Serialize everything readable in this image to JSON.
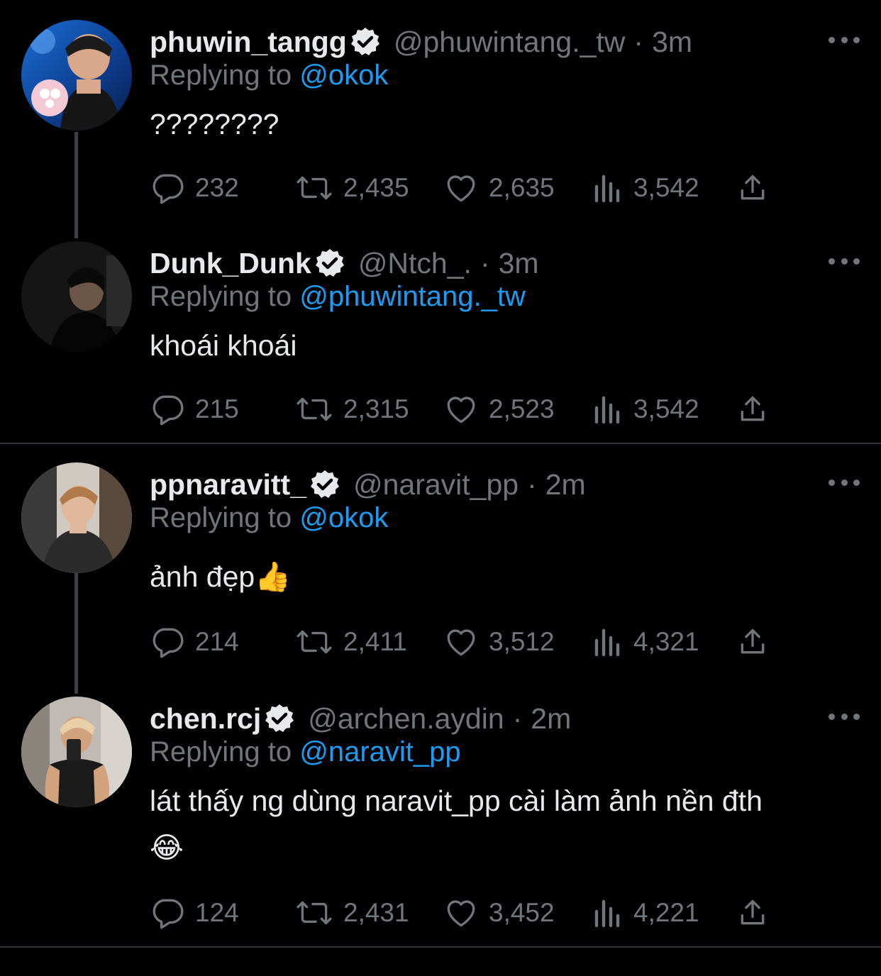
{
  "tweets": [
    {
      "name": "phuwin_tangg",
      "handle": "@phuwintang._tw",
      "dot": "·",
      "time": "3m",
      "replying_prefix": "Replying to",
      "replying_to": "@okok",
      "text": "????????",
      "replies": "232",
      "retweets": "2,435",
      "likes": "2,635",
      "views": "3,542"
    },
    {
      "name": "Dunk_Dunk",
      "handle": "@Ntch_.",
      "dot": "·",
      "time": "3m",
      "replying_prefix": "Replying to",
      "replying_to": "@phuwintang._tw",
      "text": "khoái khoái",
      "replies": "215",
      "retweets": "2,315",
      "likes": "2,523",
      "views": "3,542"
    },
    {
      "name": "ppnaravitt_",
      "handle": "@naravit_pp",
      "dot": "·",
      "time": "2m",
      "replying_prefix": "Replying to",
      "replying_to": "@okok",
      "text": "ảnh đẹp👍",
      "replies": "214",
      "retweets": "2,411",
      "likes": "3,512",
      "views": "4,321"
    },
    {
      "name": "chen.rcj",
      "handle": "@archen.aydin",
      "dot": "·",
      "time": "2m",
      "replying_prefix": "Replying to",
      "replying_to": "@naravit_pp",
      "text": "lát thấy ng dùng naravit_pp cài làm ảnh nền đth",
      "text_line2": "😂",
      "replies": "124",
      "retweets": "2,431",
      "likes": "3,452",
      "views": "4,221"
    }
  ],
  "icons": {
    "verified": "verified-badge-icon",
    "more": "more-icon",
    "reply": "reply-icon",
    "retweet": "retweet-icon",
    "like": "like-icon",
    "views": "views-icon",
    "share": "share-icon"
  },
  "colors": {
    "background": "#000000",
    "text": "#e7e9ea",
    "secondary": "#71767b",
    "mention": "#1d9bf0",
    "divider": "#2f3336"
  }
}
